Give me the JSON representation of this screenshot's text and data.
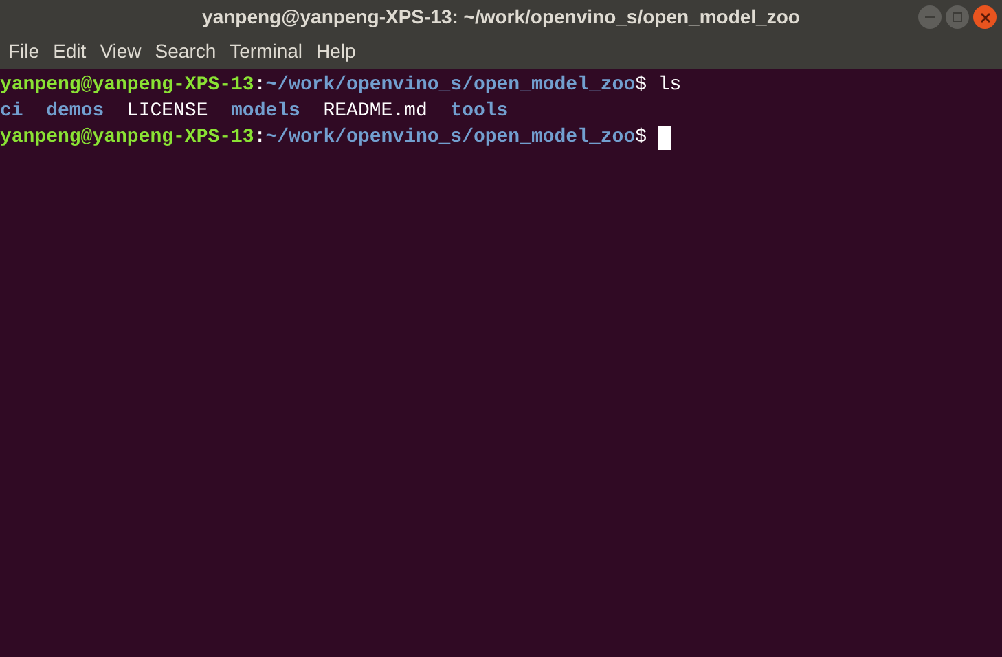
{
  "window": {
    "title": "yanpeng@yanpeng-XPS-13: ~/work/openvino_s/open_model_zoo"
  },
  "menu": [
    "File",
    "Edit",
    "View",
    "Search",
    "Terminal",
    "Help"
  ],
  "terminal": {
    "lines": [
      {
        "kind": "prompt",
        "user": "yanpeng@yanpeng-XPS-13",
        "sep": ":",
        "path": "~/work/openvino_s/open_model_zoo",
        "symbol": "$",
        "command": "ls",
        "cursor": false
      },
      {
        "kind": "listing",
        "entries": [
          {
            "name": "ci",
            "kind": "dir"
          },
          {
            "name": "demos",
            "kind": "dir"
          },
          {
            "name": "LICENSE",
            "kind": "file"
          },
          {
            "name": "models",
            "kind": "dir"
          },
          {
            "name": "README.md",
            "kind": "file"
          },
          {
            "name": "tools",
            "kind": "dir"
          }
        ]
      },
      {
        "kind": "prompt",
        "user": "yanpeng@yanpeng-XPS-13",
        "sep": ":",
        "path": "~/work/openvino_s/open_model_zoo",
        "symbol": "$",
        "cursor": true
      }
    ]
  }
}
